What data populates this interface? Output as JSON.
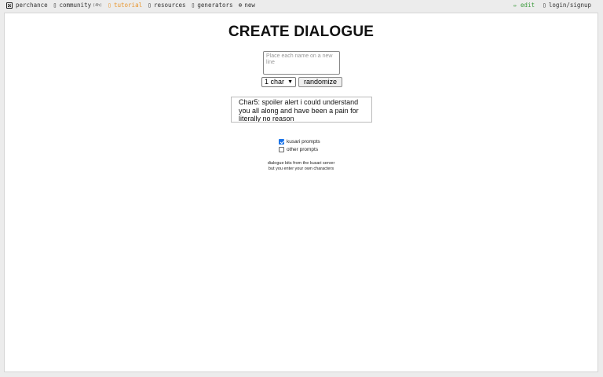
{
  "nav": {
    "items": [
      {
        "label": "perchance",
        "icon": "dice-icon"
      },
      {
        "label": "community",
        "icon": "people-icon",
        "suffix": "(4h)"
      },
      {
        "label": "tutorial",
        "icon": "book-icon"
      },
      {
        "label": "resources",
        "icon": "tools-icon"
      },
      {
        "label": "generators",
        "icon": "grid-icon"
      },
      {
        "label": "new",
        "icon": "plus-circle-icon"
      }
    ],
    "edit_label": "✏ edit",
    "login_label": "login/signup"
  },
  "main": {
    "title": "CREATE DIALOGUE",
    "names_placeholder": "Place each name on a new line",
    "char_select": "1 char",
    "randomize_label": "randomize",
    "output_text": "Char5: spoiler alert i could understand you all along and have been a pain for literally no reason",
    "checkboxes": [
      {
        "label": "kusari prompts",
        "checked": true
      },
      {
        "label": "other prompts",
        "checked": false
      }
    ],
    "footer_line1": "dialogue bits from the kusari server",
    "footer_line2": "but you enter your own characters"
  },
  "colors": {
    "tutorial": "#e8962e",
    "edit": "#3a9a3a",
    "checkbox": "#1a73e8"
  }
}
